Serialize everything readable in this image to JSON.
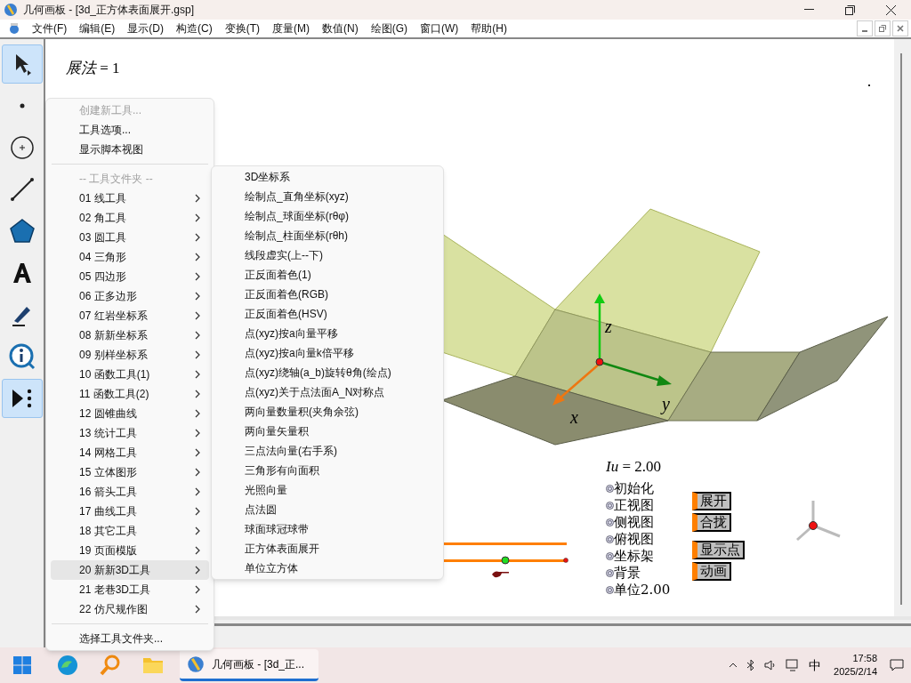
{
  "window": {
    "title": "几何画板 - [3d_正方体表面展开.gsp]"
  },
  "menu_bar": [
    "文件(F)",
    "编辑(E)",
    "显示(D)",
    "构造(C)",
    "变换(T)",
    "度量(M)",
    "数值(N)",
    "绘图(G)",
    "窗口(W)",
    "帮助(H)"
  ],
  "toolbar": [
    {
      "kind": "arrow",
      "selected": true
    },
    {
      "kind": "point",
      "selected": false
    },
    {
      "kind": "compass",
      "selected": false
    },
    {
      "kind": "segment",
      "selected": false
    },
    {
      "kind": "polygon",
      "selected": false
    },
    {
      "kind": "text",
      "selected": false
    },
    {
      "kind": "marker",
      "selected": false
    },
    {
      "kind": "info",
      "selected": false
    },
    {
      "kind": "custom",
      "selected": true
    }
  ],
  "canvas": {
    "parameter": {
      "name": "展法",
      "value": " = 1"
    },
    "measurement": {
      "name": "Iu",
      "value": " = 2.00"
    },
    "axis_labels": [
      "x",
      "y",
      "z"
    ],
    "actions": [
      "初始化",
      "正视图",
      "侧视图",
      "俯视图",
      "坐标架",
      "背景",
      "单位2.00"
    ],
    "buttons": [
      "展开",
      "合拢",
      "显示点",
      "动画"
    ]
  },
  "tool_menu": {
    "commands": [
      {
        "label": "创建新工具...",
        "disabled": true
      },
      {
        "label": "工具选项...",
        "disabled": false
      },
      {
        "label": "显示脚本视图",
        "disabled": false
      }
    ],
    "folder_header": "-- 工具文件夹 --",
    "folders": [
      {
        "label": "01 线工具",
        "selected": false
      },
      {
        "label": "02 角工具",
        "selected": false
      },
      {
        "label": "03 圆工具",
        "selected": false
      },
      {
        "label": "04 三角形",
        "selected": false
      },
      {
        "label": "05 四边形",
        "selected": false
      },
      {
        "label": "06 正多边形",
        "selected": false
      },
      {
        "label": "07 红岩坐标系",
        "selected": false
      },
      {
        "label": "08 新新坐标系",
        "selected": false
      },
      {
        "label": "09 别样坐标系",
        "selected": false
      },
      {
        "label": "10 函数工具(1)",
        "selected": false
      },
      {
        "label": "11 函数工具(2)",
        "selected": false
      },
      {
        "label": "12 圆锥曲线",
        "selected": false
      },
      {
        "label": "13 统计工具",
        "selected": false
      },
      {
        "label": "14 网格工具",
        "selected": false
      },
      {
        "label": "15 立体图形",
        "selected": false
      },
      {
        "label": "16 箭头工具",
        "selected": false
      },
      {
        "label": "17 曲线工具",
        "selected": false
      },
      {
        "label": "18 其它工具",
        "selected": false
      },
      {
        "label": "19 页面模版",
        "selected": false
      },
      {
        "label": "20 新新3D工具",
        "selected": true
      },
      {
        "label": "21 老巷3D工具",
        "selected": false
      },
      {
        "label": "22 仿尺规作图",
        "selected": false
      }
    ],
    "footer": "选择工具文件夹..."
  },
  "submenu": [
    "3D坐标系",
    "绘制点_直角坐标(xyz)",
    "绘制点_球面坐标(rθφ)",
    "绘制点_柱面坐标(rθh)",
    "线段虚实(上--下)",
    "正反面着色(1)",
    "正反面着色(RGB)",
    "正反面着色(HSV)",
    "点(xyz)按a向量平移",
    "点(xyz)按a向量k倍平移",
    "点(xyz)绕轴(a_b)旋转θ角(绘点)",
    "点(xyz)关于点法面A_N对称点",
    "两向量数量积(夹角余弦)",
    "两向量矢量积",
    "三点法向量(右手系)",
    "三角形有向面积",
    "光照向量",
    "点法圆",
    "球面球冠球带",
    "正方体表面展开",
    "单位立方体"
  ],
  "taskbar": {
    "app": "几何画板 - [3d_正...",
    "ime": "中",
    "time": "17:58",
    "date": "2025/2/14"
  }
}
